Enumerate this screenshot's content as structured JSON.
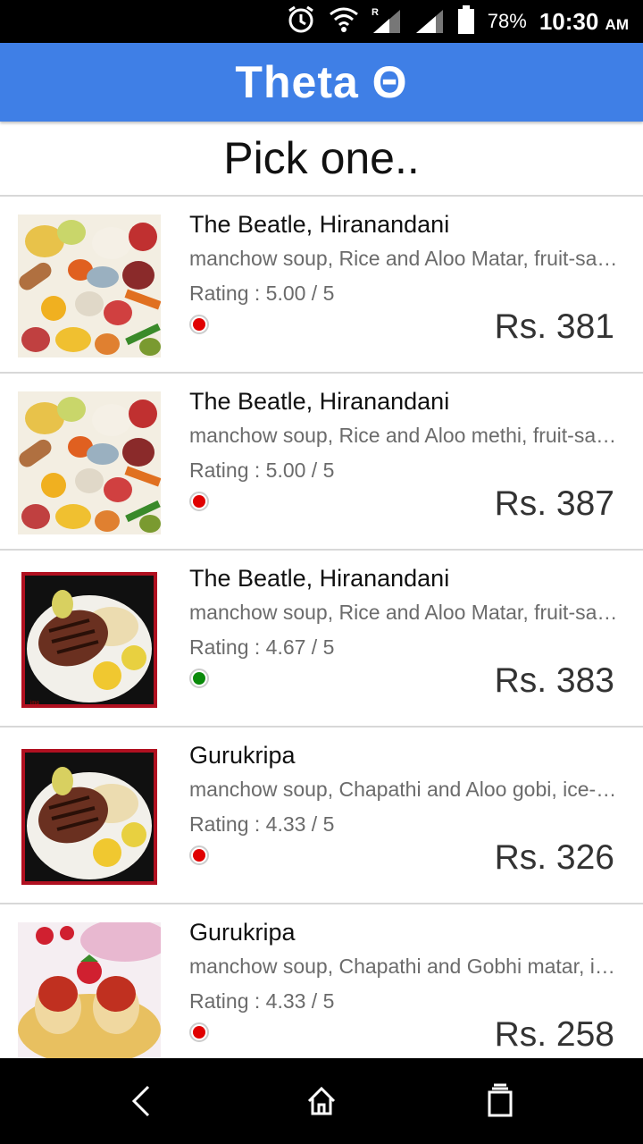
{
  "status_bar": {
    "battery_percent": "78%",
    "time": "10:30",
    "ampm": "AM",
    "icons": [
      "alarm-icon",
      "wifi-icon",
      "signal-roaming-icon",
      "signal-icon",
      "battery-icon"
    ]
  },
  "app": {
    "title": "Theta Θ",
    "accent_color": "#3f7fe6"
  },
  "heading": "Pick one..",
  "list": [
    {
      "name": "The Beatle, Hiranandani",
      "items": "manchow soup, Rice and Aloo Matar, fruit-salad",
      "rating": "Rating : 5.00 / 5",
      "status": "red",
      "price": "Rs. 381",
      "image": "vegetables"
    },
    {
      "name": "The Beatle, Hiranandani",
      "items": "manchow soup, Rice and Aloo methi, fruit-salad",
      "rating": "Rating : 5.00 / 5",
      "status": "red",
      "price": "Rs. 387",
      "image": "vegetables"
    },
    {
      "name": "The Beatle, Hiranandani",
      "items": "manchow soup, Rice and Aloo Matar, fruit-salad",
      "rating": "Rating : 4.67 / 5",
      "status": "green",
      "price": "Rs. 383",
      "image": "steak"
    },
    {
      "name": "Gurukripa",
      "items": "manchow soup, Chapathi and Aloo gobi, ice-cream",
      "rating": "Rating : 4.33 / 5",
      "status": "red",
      "price": "Rs. 326",
      "image": "steak"
    },
    {
      "name": "Gurukripa",
      "items": "manchow soup, Chapathi and Gobhi matar, ice-cream",
      "rating": "Rating : 4.33 / 5",
      "status": "red",
      "price": "Rs. 258",
      "image": "dessert"
    }
  ],
  "status_colors": {
    "red": "#e00000",
    "green": "#0a8a0a"
  },
  "nav": {
    "icons": [
      "back-icon",
      "home-icon",
      "recents-icon"
    ]
  }
}
